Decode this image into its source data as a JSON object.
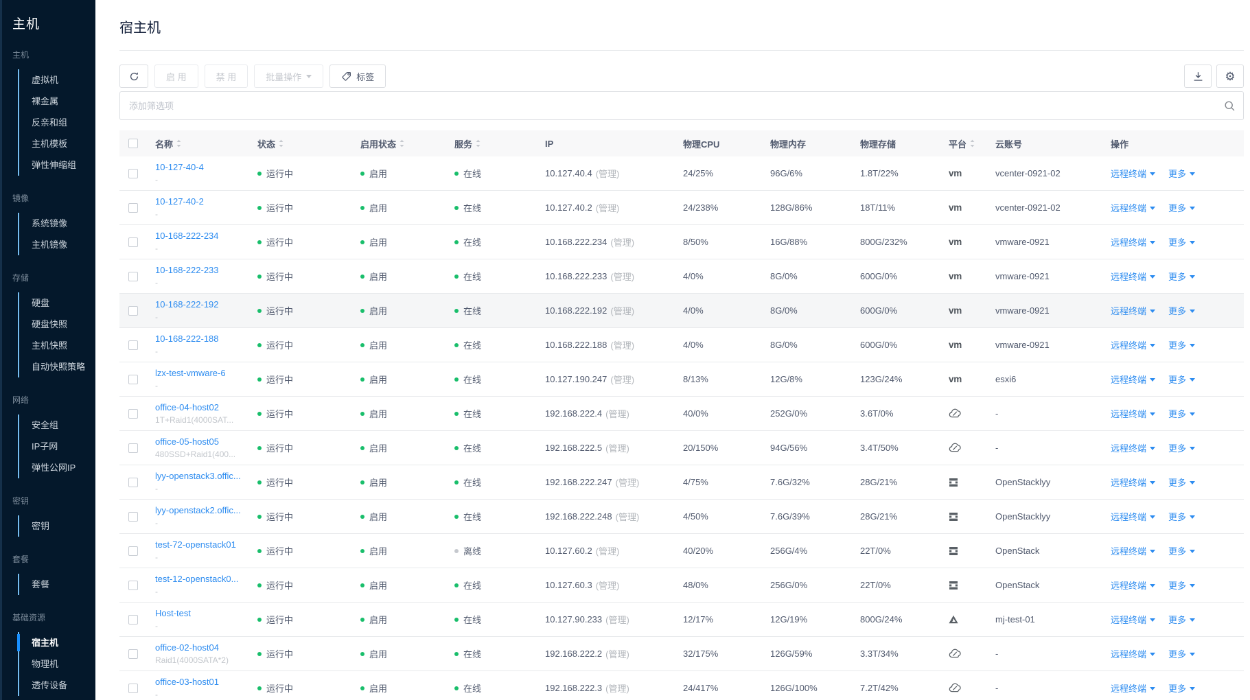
{
  "colors": {
    "accent": "#2d8cf0",
    "online": "#19be6b",
    "offline": "#c5c8ce",
    "sidebar_active": "#1890ff"
  },
  "sidebar": {
    "title": "主机",
    "sections": [
      {
        "label": "主机",
        "items": [
          {
            "label": "虚拟机"
          },
          {
            "label": "裸金属"
          },
          {
            "label": "反亲和组"
          },
          {
            "label": "主机模板"
          },
          {
            "label": "弹性伸缩组"
          }
        ]
      },
      {
        "label": "镜像",
        "items": [
          {
            "label": "系统镜像"
          },
          {
            "label": "主机镜像"
          }
        ]
      },
      {
        "label": "存储",
        "items": [
          {
            "label": "硬盘"
          },
          {
            "label": "硬盘快照"
          },
          {
            "label": "主机快照"
          },
          {
            "label": "自动快照策略"
          }
        ]
      },
      {
        "label": "网络",
        "items": [
          {
            "label": "安全组"
          },
          {
            "label": "IP子网"
          },
          {
            "label": "弹性公网IP"
          }
        ]
      },
      {
        "label": "密钥",
        "items": [
          {
            "label": "密钥"
          }
        ]
      },
      {
        "label": "套餐",
        "items": [
          {
            "label": "套餐"
          }
        ]
      },
      {
        "label": "基础资源",
        "items": [
          {
            "label": "宿主机",
            "active": true
          },
          {
            "label": "物理机"
          },
          {
            "label": "透传设备"
          }
        ]
      }
    ]
  },
  "page": {
    "title": "宿主机"
  },
  "toolbar": {
    "enable_label": "启 用",
    "disable_label": "禁 用",
    "batch_label": "批量操作",
    "tag_label": "标签"
  },
  "filter": {
    "placeholder": "添加筛选项"
  },
  "table": {
    "columns": [
      {
        "label": "名称",
        "sortable": true,
        "cls": "col-name"
      },
      {
        "label": "状态",
        "sortable": true,
        "cls": "col-status"
      },
      {
        "label": "启用状态",
        "sortable": true,
        "cls": "col-enable"
      },
      {
        "label": "服务",
        "sortable": true,
        "cls": "col-service"
      },
      {
        "label": "IP",
        "sortable": false,
        "cls": "col-ip"
      },
      {
        "label": "物理CPU",
        "sortable": false,
        "cls": "col-cpu"
      },
      {
        "label": "物理内存",
        "sortable": false,
        "cls": "col-mem"
      },
      {
        "label": "物理存储",
        "sortable": false,
        "cls": "col-storage"
      },
      {
        "label": "平台",
        "sortable": true,
        "cls": "col-platform"
      },
      {
        "label": "云账号",
        "sortable": false,
        "cls": "col-account"
      },
      {
        "label": "操作",
        "sortable": false,
        "cls": "col-actions"
      }
    ],
    "actions": {
      "remote": "远程终端",
      "more": "更多"
    },
    "ip_suffix": "(管理)",
    "rows": [
      {
        "name": "10-127-40-4",
        "sub": "-",
        "status": "运行中",
        "enabled": "启用",
        "service": "在线",
        "online": true,
        "ip": "10.127.40.4",
        "cpu": "24/25%",
        "mem": "96G/6%",
        "storage": "1.8T/22%",
        "platform": "vmware",
        "account": "vcenter-0921-02"
      },
      {
        "name": "10-127-40-2",
        "sub": "-",
        "status": "运行中",
        "enabled": "启用",
        "service": "在线",
        "online": true,
        "ip": "10.127.40.2",
        "cpu": "24/238%",
        "mem": "128G/86%",
        "storage": "18T/11%",
        "platform": "vmware",
        "account": "vcenter-0921-02"
      },
      {
        "name": "10-168-222-234",
        "sub": "-",
        "status": "运行中",
        "enabled": "启用",
        "service": "在线",
        "online": true,
        "ip": "10.168.222.234",
        "cpu": "8/50%",
        "mem": "16G/88%",
        "storage": "800G/232%",
        "platform": "vmware",
        "account": "vmware-0921"
      },
      {
        "name": "10-168-222-233",
        "sub": "-",
        "status": "运行中",
        "enabled": "启用",
        "service": "在线",
        "online": true,
        "ip": "10.168.222.233",
        "cpu": "4/0%",
        "mem": "8G/0%",
        "storage": "600G/0%",
        "platform": "vmware",
        "account": "vmware-0921"
      },
      {
        "name": "10-168-222-192",
        "sub": "-",
        "status": "运行中",
        "enabled": "启用",
        "service": "在线",
        "online": true,
        "ip": "10.168.222.192",
        "cpu": "4/0%",
        "mem": "8G/0%",
        "storage": "600G/0%",
        "platform": "vmware",
        "account": "vmware-0921",
        "highlighted": true
      },
      {
        "name": "10-168-222-188",
        "sub": "-",
        "status": "运行中",
        "enabled": "启用",
        "service": "在线",
        "online": true,
        "ip": "10.168.222.188",
        "cpu": "4/0%",
        "mem": "8G/0%",
        "storage": "600G/0%",
        "platform": "vmware",
        "account": "vmware-0921"
      },
      {
        "name": "lzx-test-vmware-6",
        "sub": "-",
        "status": "运行中",
        "enabled": "启用",
        "service": "在线",
        "online": true,
        "ip": "10.127.190.247",
        "cpu": "8/13%",
        "mem": "12G/8%",
        "storage": "123G/24%",
        "platform": "vmware",
        "account": "esxi6"
      },
      {
        "name": "office-04-host02",
        "sub": "1T+Raid1(4000SAT...",
        "status": "运行中",
        "enabled": "启用",
        "service": "在线",
        "online": true,
        "ip": "192.168.222.4",
        "cpu": "40/0%",
        "mem": "252G/0%",
        "storage": "3.6T/0%",
        "platform": "cloud",
        "account": "-"
      },
      {
        "name": "office-05-host05",
        "sub": "480SSD+Raid1(400...",
        "status": "运行中",
        "enabled": "启用",
        "service": "在线",
        "online": true,
        "ip": "192.168.222.5",
        "cpu": "20/150%",
        "mem": "94G/56%",
        "storage": "3.4T/50%",
        "platform": "cloud",
        "account": "-"
      },
      {
        "name": "lyy-openstack3.offic...",
        "sub": "-",
        "status": "运行中",
        "enabled": "启用",
        "service": "在线",
        "online": true,
        "ip": "192.168.222.247",
        "cpu": "4/75%",
        "mem": "7.6G/32%",
        "storage": "28G/21%",
        "platform": "openstack",
        "account": "OpenStacklyy"
      },
      {
        "name": "lyy-openstack2.offic...",
        "sub": "-",
        "status": "运行中",
        "enabled": "启用",
        "service": "在线",
        "online": true,
        "ip": "192.168.222.248",
        "cpu": "4/50%",
        "mem": "7.6G/39%",
        "storage": "28G/21%",
        "platform": "openstack",
        "account": "OpenStacklyy"
      },
      {
        "name": "test-72-openstack01",
        "sub": "-",
        "status": "运行中",
        "enabled": "启用",
        "service": "离线",
        "online": false,
        "ip": "10.127.60.2",
        "cpu": "40/20%",
        "mem": "256G/4%",
        "storage": "22T/0%",
        "platform": "openstack",
        "account": "OpenStack"
      },
      {
        "name": "test-12-openstack0...",
        "sub": "-",
        "status": "运行中",
        "enabled": "启用",
        "service": "在线",
        "online": true,
        "ip": "10.127.60.3",
        "cpu": "48/0%",
        "mem": "256G/0%",
        "storage": "22T/0%",
        "platform": "openstack",
        "account": "OpenStack"
      },
      {
        "name": "Host-test",
        "sub": "-",
        "status": "运行中",
        "enabled": "启用",
        "service": "在线",
        "online": true,
        "ip": "10.127.90.233",
        "cpu": "12/17%",
        "mem": "12G/19%",
        "storage": "800G/24%",
        "platform": "triangle",
        "account": "mj-test-01"
      },
      {
        "name": "office-02-host04",
        "sub": "Raid1(4000SATA*2)",
        "status": "运行中",
        "enabled": "启用",
        "service": "在线",
        "online": true,
        "ip": "192.168.222.2",
        "cpu": "32/175%",
        "mem": "126G/59%",
        "storage": "3.3T/34%",
        "platform": "cloud",
        "account": "-"
      },
      {
        "name": "office-03-host01",
        "sub": "-",
        "status": "运行中",
        "enabled": "启用",
        "service": "在线",
        "online": true,
        "ip": "192.168.222.3",
        "cpu": "24/417%",
        "mem": "126G/100%",
        "storage": "7.2T/42%",
        "platform": "cloud",
        "account": "-"
      }
    ]
  }
}
